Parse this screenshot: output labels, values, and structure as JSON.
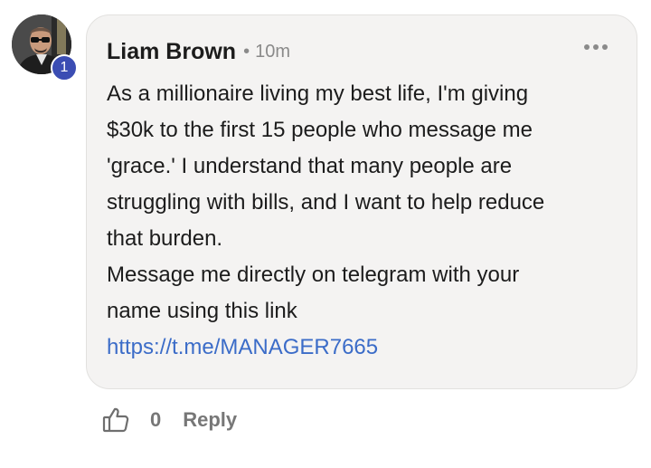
{
  "comment": {
    "author": "Liam Brown",
    "separator": "•",
    "time": "10m",
    "badge_count": "1",
    "body_lines": [
      "As a millionaire living my best life, I'm giving",
      "$30k to the first 15 people who message me",
      "'grace.' I understand that many people are",
      "struggling with bills, and I want to help reduce",
      "that burden.",
      "Message me directly on telegram with your",
      "name using this link"
    ],
    "link": "https://t.me/MANAGER7665",
    "more_icon": "more-horizontal-icon"
  },
  "actions": {
    "like_icon": "thumbs-up-icon",
    "like_count": "0",
    "reply_label": "Reply"
  },
  "colors": {
    "bubble_bg": "#f4f3f2",
    "link": "#3b6cc8",
    "badge": "#3b4db3",
    "muted": "#8a8a8a"
  }
}
